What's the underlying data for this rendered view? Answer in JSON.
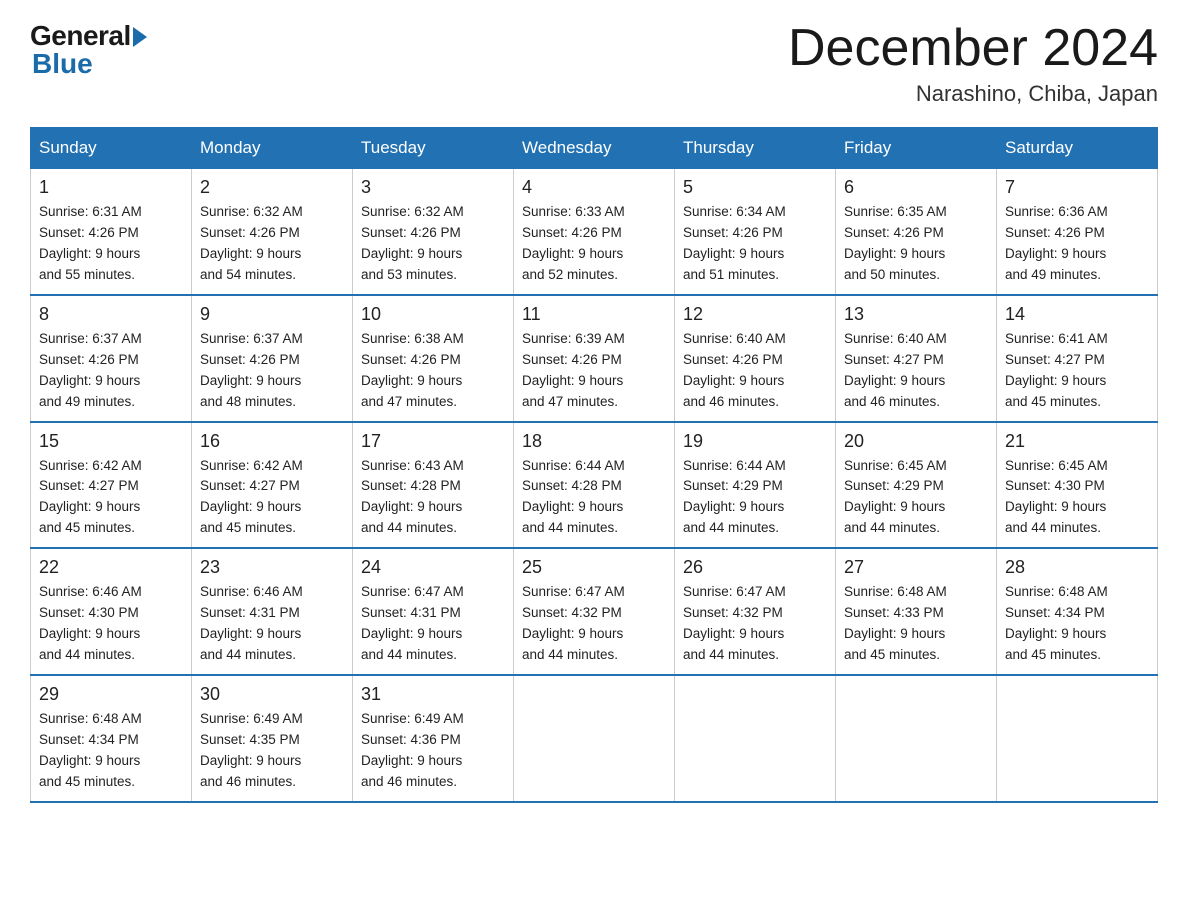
{
  "logo": {
    "general": "General",
    "blue": "Blue"
  },
  "title": "December 2024",
  "location": "Narashino, Chiba, Japan",
  "headers": [
    "Sunday",
    "Monday",
    "Tuesday",
    "Wednesday",
    "Thursday",
    "Friday",
    "Saturday"
  ],
  "weeks": [
    [
      {
        "day": "1",
        "sunrise": "6:31 AM",
        "sunset": "4:26 PM",
        "daylight": "9 hours and 55 minutes."
      },
      {
        "day": "2",
        "sunrise": "6:32 AM",
        "sunset": "4:26 PM",
        "daylight": "9 hours and 54 minutes."
      },
      {
        "day": "3",
        "sunrise": "6:32 AM",
        "sunset": "4:26 PM",
        "daylight": "9 hours and 53 minutes."
      },
      {
        "day": "4",
        "sunrise": "6:33 AM",
        "sunset": "4:26 PM",
        "daylight": "9 hours and 52 minutes."
      },
      {
        "day": "5",
        "sunrise": "6:34 AM",
        "sunset": "4:26 PM",
        "daylight": "9 hours and 51 minutes."
      },
      {
        "day": "6",
        "sunrise": "6:35 AM",
        "sunset": "4:26 PM",
        "daylight": "9 hours and 50 minutes."
      },
      {
        "day": "7",
        "sunrise": "6:36 AM",
        "sunset": "4:26 PM",
        "daylight": "9 hours and 49 minutes."
      }
    ],
    [
      {
        "day": "8",
        "sunrise": "6:37 AM",
        "sunset": "4:26 PM",
        "daylight": "9 hours and 49 minutes."
      },
      {
        "day": "9",
        "sunrise": "6:37 AM",
        "sunset": "4:26 PM",
        "daylight": "9 hours and 48 minutes."
      },
      {
        "day": "10",
        "sunrise": "6:38 AM",
        "sunset": "4:26 PM",
        "daylight": "9 hours and 47 minutes."
      },
      {
        "day": "11",
        "sunrise": "6:39 AM",
        "sunset": "4:26 PM",
        "daylight": "9 hours and 47 minutes."
      },
      {
        "day": "12",
        "sunrise": "6:40 AM",
        "sunset": "4:26 PM",
        "daylight": "9 hours and 46 minutes."
      },
      {
        "day": "13",
        "sunrise": "6:40 AM",
        "sunset": "4:27 PM",
        "daylight": "9 hours and 46 minutes."
      },
      {
        "day": "14",
        "sunrise": "6:41 AM",
        "sunset": "4:27 PM",
        "daylight": "9 hours and 45 minutes."
      }
    ],
    [
      {
        "day": "15",
        "sunrise": "6:42 AM",
        "sunset": "4:27 PM",
        "daylight": "9 hours and 45 minutes."
      },
      {
        "day": "16",
        "sunrise": "6:42 AM",
        "sunset": "4:27 PM",
        "daylight": "9 hours and 45 minutes."
      },
      {
        "day": "17",
        "sunrise": "6:43 AM",
        "sunset": "4:28 PM",
        "daylight": "9 hours and 44 minutes."
      },
      {
        "day": "18",
        "sunrise": "6:44 AM",
        "sunset": "4:28 PM",
        "daylight": "9 hours and 44 minutes."
      },
      {
        "day": "19",
        "sunrise": "6:44 AM",
        "sunset": "4:29 PM",
        "daylight": "9 hours and 44 minutes."
      },
      {
        "day": "20",
        "sunrise": "6:45 AM",
        "sunset": "4:29 PM",
        "daylight": "9 hours and 44 minutes."
      },
      {
        "day": "21",
        "sunrise": "6:45 AM",
        "sunset": "4:30 PM",
        "daylight": "9 hours and 44 minutes."
      }
    ],
    [
      {
        "day": "22",
        "sunrise": "6:46 AM",
        "sunset": "4:30 PM",
        "daylight": "9 hours and 44 minutes."
      },
      {
        "day": "23",
        "sunrise": "6:46 AM",
        "sunset": "4:31 PM",
        "daylight": "9 hours and 44 minutes."
      },
      {
        "day": "24",
        "sunrise": "6:47 AM",
        "sunset": "4:31 PM",
        "daylight": "9 hours and 44 minutes."
      },
      {
        "day": "25",
        "sunrise": "6:47 AM",
        "sunset": "4:32 PM",
        "daylight": "9 hours and 44 minutes."
      },
      {
        "day": "26",
        "sunrise": "6:47 AM",
        "sunset": "4:32 PM",
        "daylight": "9 hours and 44 minutes."
      },
      {
        "day": "27",
        "sunrise": "6:48 AM",
        "sunset": "4:33 PM",
        "daylight": "9 hours and 45 minutes."
      },
      {
        "day": "28",
        "sunrise": "6:48 AM",
        "sunset": "4:34 PM",
        "daylight": "9 hours and 45 minutes."
      }
    ],
    [
      {
        "day": "29",
        "sunrise": "6:48 AM",
        "sunset": "4:34 PM",
        "daylight": "9 hours and 45 minutes."
      },
      {
        "day": "30",
        "sunrise": "6:49 AM",
        "sunset": "4:35 PM",
        "daylight": "9 hours and 46 minutes."
      },
      {
        "day": "31",
        "sunrise": "6:49 AM",
        "sunset": "4:36 PM",
        "daylight": "9 hours and 46 minutes."
      },
      null,
      null,
      null,
      null
    ]
  ]
}
